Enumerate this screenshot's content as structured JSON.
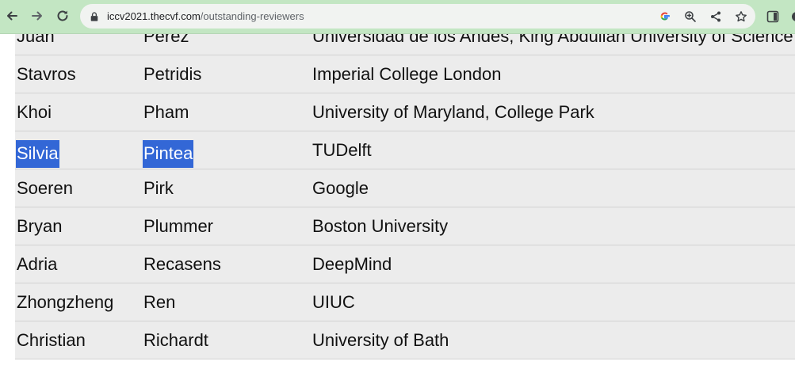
{
  "browser": {
    "url_host": "iccv2021.thecvf.com",
    "url_path": "/outstanding-reviewers"
  },
  "reviewers": {
    "rows": [
      {
        "first": "Juan",
        "last": "Perez",
        "institution": "Universidad de los Andes, King Abdullah University of Science"
      },
      {
        "first": "Stavros",
        "last": "Petridis",
        "institution": "Imperial College London"
      },
      {
        "first": "Khoi",
        "last": "Pham",
        "institution": "University of Maryland, College Park"
      },
      {
        "first": "Silvia",
        "last": "Pintea",
        "institution": "TUDelft",
        "selected": true
      },
      {
        "first": "Soeren",
        "last": "Pirk",
        "institution": "Google"
      },
      {
        "first": "Bryan",
        "last": "Plummer",
        "institution": "Boston University"
      },
      {
        "first": "Adria",
        "last": "Recasens",
        "institution": "DeepMind"
      },
      {
        "first": "Zhongzheng",
        "last": "Ren",
        "institution": "UIUC"
      },
      {
        "first": "Christian",
        "last": "Richardt",
        "institution": "University of Bath"
      }
    ]
  },
  "colors": {
    "toolbar": "#c3e6c3",
    "row_background": "#ececec",
    "selection": "#3367d6"
  },
  "icons": [
    "back-icon",
    "forward-icon",
    "reload-icon",
    "lock-icon",
    "google-icon",
    "zoom-icon",
    "share-icon",
    "bookmark-star-icon",
    "extension-icon"
  ]
}
